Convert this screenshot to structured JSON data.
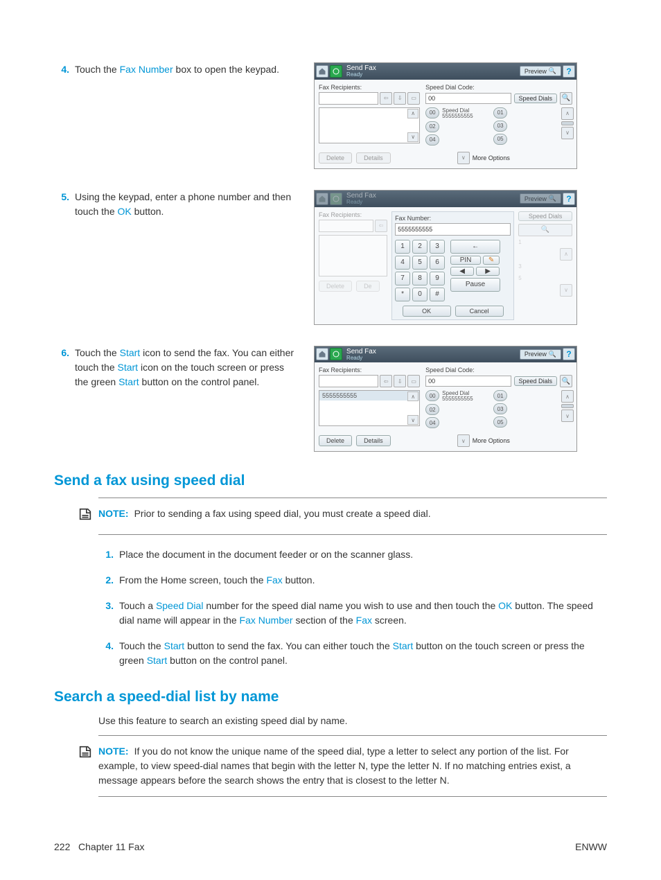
{
  "steps": {
    "s4": {
      "num": "4.",
      "text_a": "Touch the ",
      "link1": "Fax Number",
      "text_b": " box to open the keypad."
    },
    "s5": {
      "num": "5.",
      "text_a": "Using the keypad, enter a phone number and then touch the ",
      "link1": "OK",
      "text_b": " button."
    },
    "s6": {
      "num": "6.",
      "text_a": "Touch the ",
      "link1": "Start",
      "text_b": " icon to send the fax. You can either touch the ",
      "link2": "Start",
      "text_c": " icon on the touch screen or press the green ",
      "link3": "Start",
      "text_d": " button on the control panel."
    }
  },
  "h2_1": "Send a fax using speed dial",
  "note1": {
    "label": "NOTE:",
    "text": "Prior to sending a fax using speed dial, you must create a speed dial."
  },
  "list": {
    "i1": {
      "num": "1.",
      "text": "Place the document in the document feeder or on the scanner glass."
    },
    "i2": {
      "num": "2.",
      "text_a": "From the Home screen, touch the ",
      "link1": "Fax",
      "text_b": " button."
    },
    "i3": {
      "num": "3.",
      "text_a": "Touch a ",
      "link1": "Speed Dial",
      "text_b": " number for the speed dial name you wish to use and then touch the ",
      "link2": "OK",
      "text_c": " button. The speed dial name will appear in the ",
      "link3": "Fax Number",
      "text_d": " section of the ",
      "link4": "Fax",
      "text_e": " screen."
    },
    "i4": {
      "num": "4.",
      "text_a": "Touch the ",
      "link1": "Start",
      "text_b": " button to send the fax. You can either touch the ",
      "link2": "Start",
      "text_c": " button on the touch screen or press the green ",
      "link3": "Start",
      "text_d": " button on the control panel."
    }
  },
  "h2_2": "Search a speed-dial list by name",
  "para2": "Use this feature to search an existing speed dial by name.",
  "note2": {
    "label": "NOTE:",
    "text": "If you do not know the unique name of the speed dial, type a letter to select any portion of the list. For example, to view speed-dial names that begin with the letter N, type the letter N. If no matching entries exist, a message appears before the search shows the entry that is closest to the letter N."
  },
  "footer": {
    "left_page": "222",
    "left_chapter": "Chapter 11   Fax",
    "right": "ENWW"
  },
  "ss": {
    "title": "Send Fax",
    "subtitle": "Ready",
    "preview": "Preview",
    "faxrecip": "Fax Recipients:",
    "sdcode": "Speed Dial Code:",
    "sdials": "Speed Dials",
    "delete": "Delete",
    "details": "Details",
    "more": "More Options",
    "sd00": "00",
    "sd01": "01",
    "sd02": "02",
    "sd03": "03",
    "sd04": "04",
    "sd05": "05",
    "sdentry": "Speed Dial",
    "sdnum": "5555555555",
    "faxnum_label": "Fax Number:",
    "faxnum_val": "5555555555",
    "ok": "OK",
    "cancel": "Cancel",
    "pin": "PIN",
    "pause": "Pause",
    "back": "←",
    "k1": "1",
    "k2": "2",
    "k3": "3",
    "k4": "4",
    "k5": "5",
    "k6": "6",
    "k7": "7",
    "k8": "8",
    "k9": "9",
    "kst": "*",
    "k0": "0",
    "kh": "#",
    "recip_entry": "5555555555"
  }
}
